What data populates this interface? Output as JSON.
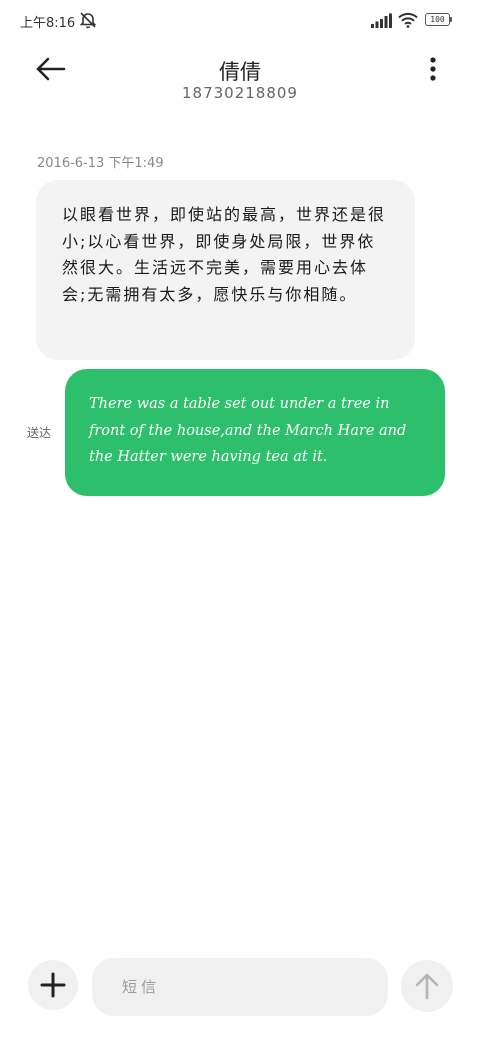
{
  "status_bar": {
    "time": "上午8:16",
    "battery": "100",
    "icons": [
      "mute-icon",
      "signal-icon",
      "wifi-icon",
      "battery-icon"
    ]
  },
  "header": {
    "contact_name": "倩倩",
    "phone_number": "18730218809",
    "icons": [
      "back-arrow-icon",
      "more-vertical-icon"
    ]
  },
  "conversation": {
    "timestamp": "2016-6-13 下午1:49",
    "incoming_message": "以眼看世界，即使站的最高，世界还是很小;以心看世界，即使身处局限，世界依然很大。生活远不完美，需要用心去体会;无需拥有太多，愿快乐与你相随。",
    "outgoing_message": "There was a table set out under a tree in front of the house,and the March Hare and the Hatter were having tea at it.",
    "outgoing_status": "送达",
    "colors": {
      "incoming_bubble": "#f3f3f3",
      "outgoing_bubble": "#2ebf6c"
    }
  },
  "composer": {
    "placeholder": "短信",
    "icons": [
      "plus-icon",
      "send-arrow-icon"
    ]
  }
}
